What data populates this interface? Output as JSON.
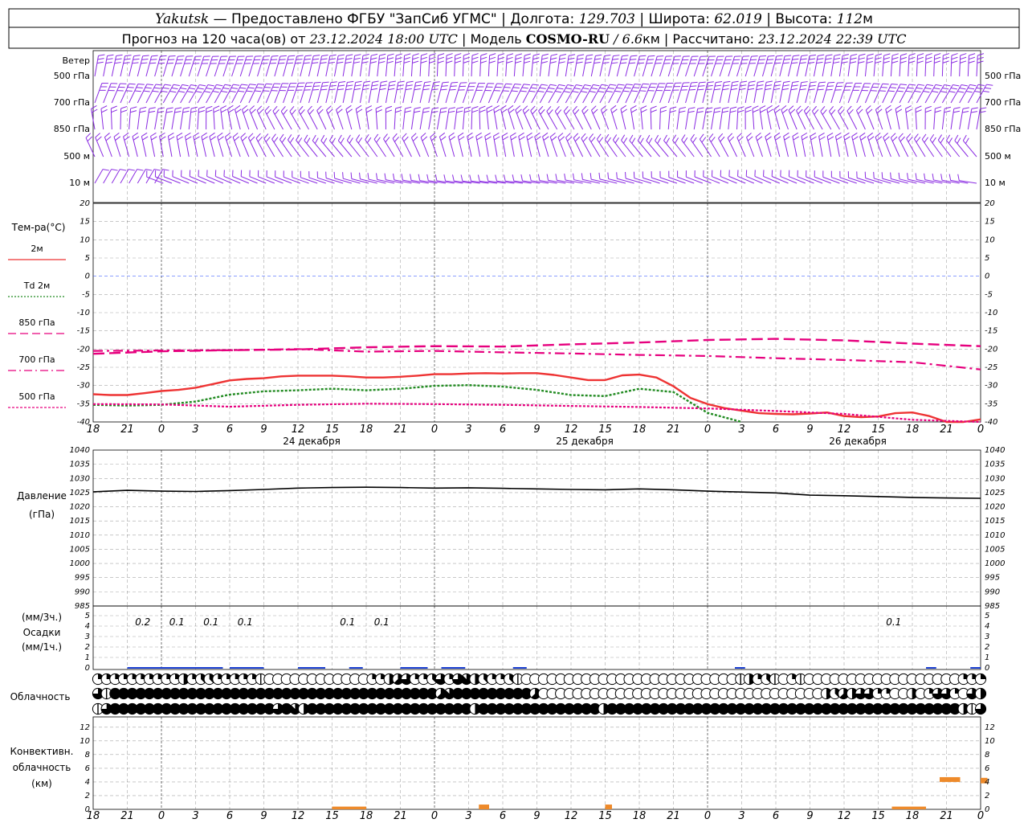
{
  "header": {
    "line1": {
      "station": "Yakutsk",
      "provider": " — Предоставлено ФГБУ \"ЗапСиб УГМС\" | Долгота: ",
      "lon": "129.703",
      "lat_label": " | Широта: ",
      "lat": "62.019",
      "alt_label": " | Высота: ",
      "alt": "112",
      "alt_unit": "м"
    },
    "line2": {
      "prefix": "Прогноз на 120 часа(ов) от ",
      "start": "23.12.2024 18:00 UTC",
      "model_label": " | Модель ",
      "model": "COSMO-RU",
      "res": " / 6.6",
      "res_unit": "км",
      "calc_label": " | Рассчитано: ",
      "calc": "23.12.2024 22:39 UTC"
    }
  },
  "time_axis": {
    "hour_labels": [
      "18",
      "21",
      "0",
      "3",
      "6",
      "9",
      "12",
      "15",
      "18",
      "21",
      "0",
      "3",
      "6",
      "9",
      "12",
      "15",
      "18",
      "21",
      "0",
      "3",
      "6",
      "9",
      "12",
      "15",
      "18",
      "21",
      "0"
    ],
    "days": [
      "24 декабря",
      "25 декабря",
      "26 декабря"
    ]
  },
  "panels": {
    "wind": {
      "title": "Ветер",
      "levels": [
        "500 гПа",
        "700 гПа",
        "850 гПа",
        "500 м",
        "10  м"
      ],
      "color": "#8a2be2"
    },
    "temperature": {
      "title": "Тем-ра(°C)",
      "legend": [
        {
          "label": "2м",
          "color": "#ee3333",
          "style": "solid"
        },
        {
          "label": "Td  2м",
          "color": "#228b22",
          "style": "dotted"
        },
        {
          "label": "850  гПа",
          "color": "#e6007e",
          "style": "dashed"
        },
        {
          "label": "700  гПа",
          "color": "#e6007e",
          "style": "dashdot"
        },
        {
          "label": "500  гПа",
          "color": "#e6007e",
          "style": "densedot"
        }
      ],
      "ticks": [
        "20",
        "15",
        "10",
        "5",
        "0",
        "-5",
        "-10",
        "-15",
        "-20",
        "-25",
        "-30",
        "-35",
        "-40"
      ]
    },
    "pressure": {
      "title1": "Давление",
      "title2": "(гПа)",
      "ticks": [
        "1040",
        "1035",
        "1030",
        "1025",
        "1020",
        "1015",
        "1010",
        "1005",
        "1000",
        "995",
        "990",
        "985"
      ]
    },
    "precip": {
      "title1": "(мм/3ч.)",
      "title2": "Осадки",
      "title3": "(мм/1ч.)",
      "ticks": [
        "5",
        "4",
        "3",
        "2",
        "1",
        "0"
      ],
      "values": [
        {
          "hour_index": 1,
          "text": "0.2"
        },
        {
          "hour_index": 2,
          "text": "0.1"
        },
        {
          "hour_index": 3,
          "text": "0.1"
        },
        {
          "hour_index": 4,
          "text": "0.1"
        },
        {
          "hour_index": 7,
          "text": "0.1"
        },
        {
          "hour_index": 8,
          "text": "0.1"
        },
        {
          "hour_index": 23,
          "text": "0.1"
        }
      ]
    },
    "cloud": {
      "title": "Облачность"
    },
    "convective": {
      "title1": "Конвективн.",
      "title2": "облачность",
      "title3": "(км)",
      "ticks": [
        "12",
        "10",
        "8",
        "6",
        "4",
        "2",
        "0"
      ]
    }
  },
  "chart_data": [
    {
      "type": "line",
      "title": "Тем-ра(°C)",
      "x_unit": "hours from 23.12.2024 18:00 UTC",
      "ylim": [
        -40,
        20
      ],
      "series": [
        {
          "name": "2м",
          "x": [
            0,
            6,
            12,
            18,
            24,
            30,
            36,
            42,
            48,
            54,
            60,
            66,
            72,
            78,
            84,
            90,
            96,
            102,
            108,
            114,
            120,
            126,
            132,
            138,
            144,
            150,
            156,
            162,
            168,
            174,
            180,
            186,
            192,
            198,
            204,
            210,
            216,
            222,
            228,
            234,
            240,
            246,
            252,
            258,
            264,
            270,
            276,
            282,
            288,
            294,
            300,
            306,
            312
          ],
          "values": [
            -32.4,
            -32.6,
            -32.6,
            -32.1,
            -31.5,
            -31.2,
            -30.6,
            -29.6,
            -28.6,
            -28.2,
            -28.0,
            -27.5,
            -27.3,
            -27.3,
            -27.3,
            -27.5,
            -27.8,
            -27.8,
            -27.6,
            -27.3,
            -26.9,
            -26.9,
            -26.7,
            -26.6,
            -26.7,
            -26.6,
            -26.6,
            -27.1,
            -27.8,
            -28.5,
            -28.5,
            -27.2,
            -27.0,
            -27.8,
            -30.2,
            -33.4,
            -35.1,
            -36.2,
            -36.9,
            -37.6,
            -37.8,
            -37.9,
            -37.7,
            -37.4,
            -38.4,
            -38.7,
            -38.5,
            -37.6,
            -37.4,
            -38.4,
            -40.0,
            -40.0,
            -39.3
          ]
        },
        {
          "name": "Td  2м",
          "x": [
            0,
            12,
            24,
            36,
            48,
            60,
            72,
            84,
            96,
            108,
            120,
            132,
            144,
            156,
            168,
            180,
            192,
            204,
            216,
            228
          ],
          "values": [
            -35.3,
            -35.5,
            -35.3,
            -34.4,
            -32.5,
            -31.6,
            -31.3,
            -30.9,
            -31.3,
            -30.9,
            -30.1,
            -29.9,
            -30.3,
            -31.2,
            -32.6,
            -32.9,
            -30.9,
            -31.8,
            -37.5,
            -40.0
          ]
        },
        {
          "name": "850  гПа",
          "x": [
            0,
            24,
            48,
            72,
            96,
            120,
            144,
            168,
            192,
            216,
            240,
            264,
            288,
            312
          ],
          "values": [
            -21.3,
            -20.6,
            -20.3,
            -20.1,
            -19.5,
            -19.2,
            -19.3,
            -18.7,
            -18.2,
            -17.5,
            -17.2,
            -17.6,
            -18.5,
            -19.2
          ]
        },
        {
          "name": "700  гПа",
          "x": [
            0,
            24,
            48,
            72,
            96,
            120,
            144,
            168,
            192,
            216,
            240,
            264,
            288,
            312
          ],
          "values": [
            -20.5,
            -20.4,
            -20.3,
            -20.0,
            -20.7,
            -20.5,
            -20.9,
            -21.2,
            -21.6,
            -21.9,
            -22.5,
            -23.0,
            -23.6,
            -25.6
          ]
        },
        {
          "name": "500  гПа",
          "x": [
            0,
            24,
            48,
            72,
            96,
            120,
            144,
            168,
            192,
            216,
            240,
            264,
            288,
            312
          ],
          "values": [
            -35.1,
            -35.2,
            -35.8,
            -35.3,
            -35.0,
            -35.1,
            -35.3,
            -35.6,
            -35.9,
            -36.3,
            -37.0,
            -37.8,
            -39.4,
            -40.0
          ]
        }
      ]
    },
    {
      "type": "line",
      "title": "Давление (гПа)",
      "ylim": [
        985,
        1040
      ],
      "series": [
        {
          "name": "pressure",
          "x": [
            0,
            12,
            24,
            36,
            48,
            60,
            72,
            84,
            96,
            108,
            120,
            132,
            144,
            156,
            168,
            180,
            192,
            204,
            216,
            228,
            240,
            252,
            264,
            276,
            288,
            300,
            312
          ],
          "values": [
            1025.3,
            1025.8,
            1025.5,
            1025.4,
            1025.7,
            1026.1,
            1026.6,
            1026.8,
            1026.9,
            1026.8,
            1026.6,
            1026.7,
            1026.5,
            1026.3,
            1026.1,
            1026.0,
            1026.3,
            1026.0,
            1025.5,
            1025.2,
            1024.9,
            1024.1,
            1023.9,
            1023.6,
            1023.3,
            1023.1,
            1023.0
          ]
        }
      ]
    }
  ]
}
